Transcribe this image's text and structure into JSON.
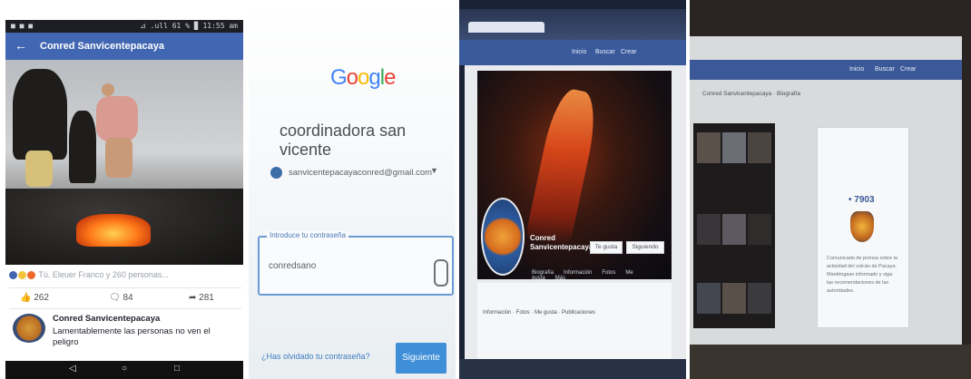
{
  "phone": {
    "status_left": "■ ■ ■",
    "status_right": "⊿ .ull 61 % ▉ 11:55 am",
    "back_icon": "←",
    "header_title": "Conred Sanvicentepacaya",
    "reactions_text": "Tú, Eleuer Franco y 260 personas...",
    "like_count": "262",
    "comment_count": "84",
    "share_count": "281",
    "comment_author": "Conred Sanvicentepacaya",
    "comment_text": "Lamentablemente las personas no ven el peligro",
    "nav_back": "◁",
    "nav_home": "○",
    "nav_recent": "□",
    "reaction_colors": [
      "#4267b2",
      "#f5c33b",
      "#f0692a"
    ]
  },
  "google": {
    "logo_letters": [
      "G",
      "o",
      "o",
      "g",
      "l",
      "e"
    ],
    "logo_colors": [
      "#4285f4",
      "#ea4335",
      "#fbbc05",
      "#4285f4",
      "#34a853",
      "#ea4335"
    ],
    "account_name": "coordinadora san vicente",
    "account_email": "sanvicentepacayaconred@gmail.com",
    "password_label": "Introduce tu contraseña",
    "password_value": "conredsano",
    "forgot_link": "¿Has olvidado tu contraseña?",
    "next_button": "Siguiente"
  },
  "desktop_cover": {
    "nav_items": [
      "Inicio",
      "Buscar",
      "Crear"
    ],
    "page_name_line1": "Conred",
    "page_name_line2": "Sanvicentepacaya",
    "btn_liked": "Te gusta",
    "btn_follow": "Siguiendo",
    "tabs": [
      "Biografía",
      "Información",
      "Fotos",
      "Me gusta",
      "Más"
    ],
    "stats": "Información · Fotos · Me gusta · Publicaciones"
  },
  "desktop_page": {
    "nav_items": [
      "Inicio",
      "Buscar",
      "Crear"
    ],
    "page_header": "Conred Sanvicentepacaya · Biografía",
    "badge": "• 7903",
    "post_text": "Comunicado de prensa sobre la actividad del volcán de Pacaya. Manténgase informado y siga las recomendaciones de las autoridades."
  }
}
